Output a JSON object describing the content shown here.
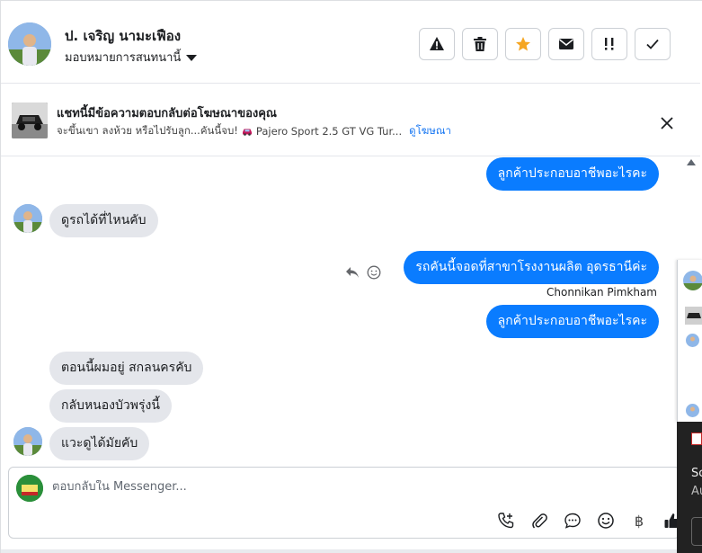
{
  "header": {
    "contact_name": "ป. เจริญ นามะเฟือง",
    "assign_label": "มอบหมายการสนทนานี้",
    "actions": [
      {
        "name": "spam-button",
        "icon": "warning-icon"
      },
      {
        "name": "delete-button",
        "icon": "trash-icon"
      },
      {
        "name": "star-button",
        "icon": "star-icon"
      },
      {
        "name": "mark-unread-button",
        "icon": "envelope-icon"
      },
      {
        "name": "follow-up-button",
        "icon": "exclamation-icon"
      },
      {
        "name": "mark-done-button",
        "icon": "check-icon"
      }
    ],
    "star_color": "#f5a623"
  },
  "ad_banner": {
    "title": "แชทนี้มีข้อความตอบกลับต่อโฆษณาของคุณ",
    "ad_text": "จะขึ้นเขา ลงห้วย หรือไปรับลูก...คันนี้จบ!",
    "ad_product": "Pajero Sport 2.5 GT VG Tur...",
    "view_ad_link": "ดูโฆษณา"
  },
  "conversation": {
    "messages": [
      {
        "direction": "out",
        "text": "ลูกค้าประกอบอาชีพอะไรคะ"
      },
      {
        "direction": "in",
        "text": "ดูรถได้ที่ไหนคับ"
      },
      {
        "direction": "out",
        "text": "รถคันนี้จอดที่สาขาโรงงานผลิต อุดรธานีค่ะ"
      },
      {
        "direction": "out",
        "text": "ลูกค้าประกอบอาชีพอะไรคะ"
      },
      {
        "direction": "in",
        "text": "ตอนนี้ผมอยู่ สกลนครคับ"
      },
      {
        "direction": "in",
        "text": "กลับหนองบัวพรุ่งนี้"
      },
      {
        "direction": "in",
        "text": "แวะดูได้มัยคับ"
      }
    ],
    "sender_name": "Chonnikan Pimkham"
  },
  "composer": {
    "placeholder": "ตอบกลับใน Messenger...",
    "tools": [
      "call-icon",
      "attach-icon",
      "saved-replies-icon",
      "emoji-icon",
      "baht-icon",
      "like-icon"
    ],
    "baht_symbol": "฿"
  },
  "side_panel": {
    "text_line1": "Sc",
    "text_line2": "Au"
  },
  "colors": {
    "accent": "#0a7cff",
    "incoming_bubble": "#e4e6eb",
    "link": "#1877f2"
  }
}
